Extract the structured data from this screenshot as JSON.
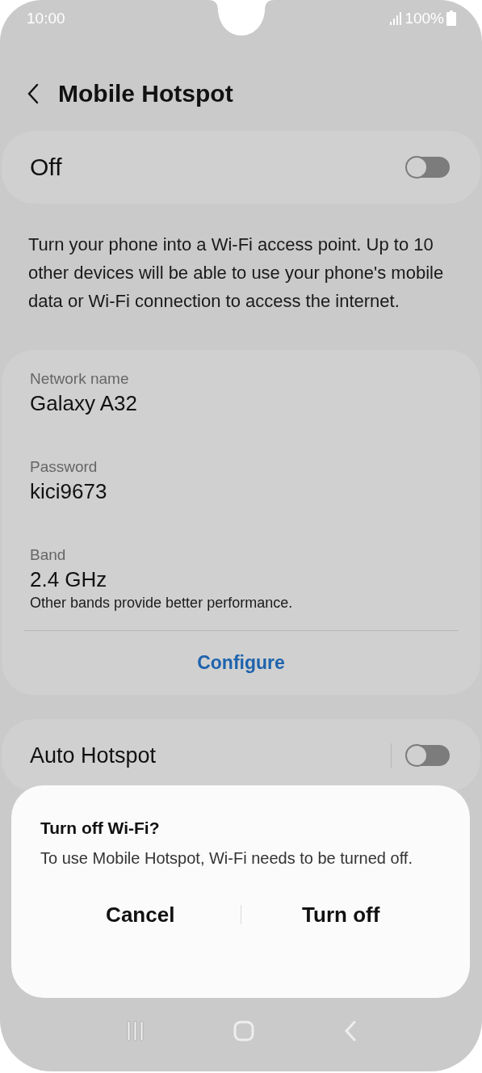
{
  "status_bar": {
    "time": "10:00",
    "battery": "100%"
  },
  "header": {
    "title": "Mobile Hotspot"
  },
  "master_switch": {
    "label": "Off",
    "on": false
  },
  "description": "Turn your phone into a Wi-Fi access point. Up to 10 other devices will be able to use your phone's mobile data or Wi-Fi connection to access the internet.",
  "network": {
    "fields": [
      {
        "label": "Network name",
        "value": "Galaxy A32"
      },
      {
        "label": "Password",
        "value": "kici9673"
      },
      {
        "label": "Band",
        "value": "2.4 GHz",
        "note": "Other bands provide better performance."
      }
    ],
    "configure": "Configure"
  },
  "auto_hotspot": {
    "label": "Auto Hotspot",
    "on": false
  },
  "dialog": {
    "title": "Turn off Wi-Fi?",
    "message": "To use Mobile Hotspot, Wi-Fi needs to be turned off.",
    "buttons": [
      "Cancel",
      "Turn off"
    ]
  }
}
